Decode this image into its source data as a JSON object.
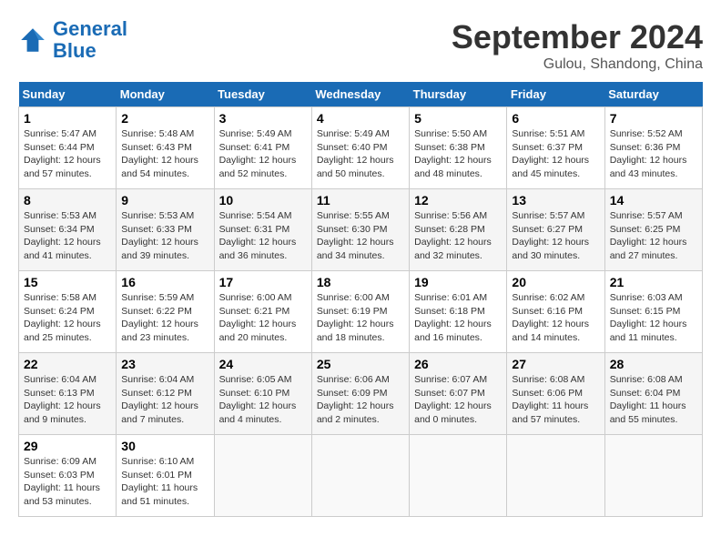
{
  "header": {
    "logo_line1": "General",
    "logo_line2": "Blue",
    "month": "September 2024",
    "location": "Gulou, Shandong, China"
  },
  "weekdays": [
    "Sunday",
    "Monday",
    "Tuesday",
    "Wednesday",
    "Thursday",
    "Friday",
    "Saturday"
  ],
  "weeks": [
    [
      {
        "day": "1",
        "info": "Sunrise: 5:47 AM\nSunset: 6:44 PM\nDaylight: 12 hours\nand 57 minutes."
      },
      {
        "day": "2",
        "info": "Sunrise: 5:48 AM\nSunset: 6:43 PM\nDaylight: 12 hours\nand 54 minutes."
      },
      {
        "day": "3",
        "info": "Sunrise: 5:49 AM\nSunset: 6:41 PM\nDaylight: 12 hours\nand 52 minutes."
      },
      {
        "day": "4",
        "info": "Sunrise: 5:49 AM\nSunset: 6:40 PM\nDaylight: 12 hours\nand 50 minutes."
      },
      {
        "day": "5",
        "info": "Sunrise: 5:50 AM\nSunset: 6:38 PM\nDaylight: 12 hours\nand 48 minutes."
      },
      {
        "day": "6",
        "info": "Sunrise: 5:51 AM\nSunset: 6:37 PM\nDaylight: 12 hours\nand 45 minutes."
      },
      {
        "day": "7",
        "info": "Sunrise: 5:52 AM\nSunset: 6:36 PM\nDaylight: 12 hours\nand 43 minutes."
      }
    ],
    [
      {
        "day": "8",
        "info": "Sunrise: 5:53 AM\nSunset: 6:34 PM\nDaylight: 12 hours\nand 41 minutes."
      },
      {
        "day": "9",
        "info": "Sunrise: 5:53 AM\nSunset: 6:33 PM\nDaylight: 12 hours\nand 39 minutes."
      },
      {
        "day": "10",
        "info": "Sunrise: 5:54 AM\nSunset: 6:31 PM\nDaylight: 12 hours\nand 36 minutes."
      },
      {
        "day": "11",
        "info": "Sunrise: 5:55 AM\nSunset: 6:30 PM\nDaylight: 12 hours\nand 34 minutes."
      },
      {
        "day": "12",
        "info": "Sunrise: 5:56 AM\nSunset: 6:28 PM\nDaylight: 12 hours\nand 32 minutes."
      },
      {
        "day": "13",
        "info": "Sunrise: 5:57 AM\nSunset: 6:27 PM\nDaylight: 12 hours\nand 30 minutes."
      },
      {
        "day": "14",
        "info": "Sunrise: 5:57 AM\nSunset: 6:25 PM\nDaylight: 12 hours\nand 27 minutes."
      }
    ],
    [
      {
        "day": "15",
        "info": "Sunrise: 5:58 AM\nSunset: 6:24 PM\nDaylight: 12 hours\nand 25 minutes."
      },
      {
        "day": "16",
        "info": "Sunrise: 5:59 AM\nSunset: 6:22 PM\nDaylight: 12 hours\nand 23 minutes."
      },
      {
        "day": "17",
        "info": "Sunrise: 6:00 AM\nSunset: 6:21 PM\nDaylight: 12 hours\nand 20 minutes."
      },
      {
        "day": "18",
        "info": "Sunrise: 6:00 AM\nSunset: 6:19 PM\nDaylight: 12 hours\nand 18 minutes."
      },
      {
        "day": "19",
        "info": "Sunrise: 6:01 AM\nSunset: 6:18 PM\nDaylight: 12 hours\nand 16 minutes."
      },
      {
        "day": "20",
        "info": "Sunrise: 6:02 AM\nSunset: 6:16 PM\nDaylight: 12 hours\nand 14 minutes."
      },
      {
        "day": "21",
        "info": "Sunrise: 6:03 AM\nSunset: 6:15 PM\nDaylight: 12 hours\nand 11 minutes."
      }
    ],
    [
      {
        "day": "22",
        "info": "Sunrise: 6:04 AM\nSunset: 6:13 PM\nDaylight: 12 hours\nand 9 minutes."
      },
      {
        "day": "23",
        "info": "Sunrise: 6:04 AM\nSunset: 6:12 PM\nDaylight: 12 hours\nand 7 minutes."
      },
      {
        "day": "24",
        "info": "Sunrise: 6:05 AM\nSunset: 6:10 PM\nDaylight: 12 hours\nand 4 minutes."
      },
      {
        "day": "25",
        "info": "Sunrise: 6:06 AM\nSunset: 6:09 PM\nDaylight: 12 hours\nand 2 minutes."
      },
      {
        "day": "26",
        "info": "Sunrise: 6:07 AM\nSunset: 6:07 PM\nDaylight: 12 hours\nand 0 minutes."
      },
      {
        "day": "27",
        "info": "Sunrise: 6:08 AM\nSunset: 6:06 PM\nDaylight: 11 hours\nand 57 minutes."
      },
      {
        "day": "28",
        "info": "Sunrise: 6:08 AM\nSunset: 6:04 PM\nDaylight: 11 hours\nand 55 minutes."
      }
    ],
    [
      {
        "day": "29",
        "info": "Sunrise: 6:09 AM\nSunset: 6:03 PM\nDaylight: 11 hours\nand 53 minutes."
      },
      {
        "day": "30",
        "info": "Sunrise: 6:10 AM\nSunset: 6:01 PM\nDaylight: 11 hours\nand 51 minutes."
      },
      {
        "day": "",
        "info": ""
      },
      {
        "day": "",
        "info": ""
      },
      {
        "day": "",
        "info": ""
      },
      {
        "day": "",
        "info": ""
      },
      {
        "day": "",
        "info": ""
      }
    ]
  ]
}
